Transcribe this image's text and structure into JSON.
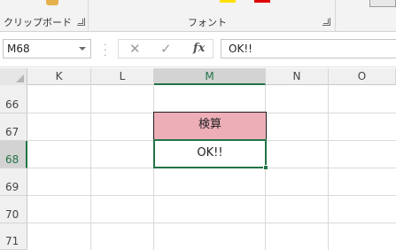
{
  "ribbon": {
    "clipboard_label": "クリップボード",
    "font_label": "フォント",
    "colors": {
      "highlight": "#ffe100",
      "font_red": "#e00000",
      "brush": "#e3b04b"
    }
  },
  "formula_bar": {
    "name_box": "M68",
    "cancel_icon": "✕",
    "enter_icon": "✓",
    "fx_icon": "fx",
    "content": "OK!!"
  },
  "columns": [
    "K",
    "L",
    "M",
    "N",
    "O"
  ],
  "active_column": "M",
  "rows": [
    "66",
    "67",
    "68",
    "69",
    "70",
    "71"
  ],
  "active_row": "68",
  "cells": {
    "M67": "検算",
    "M68": "OK!!"
  },
  "colors": {
    "accent": "#217346",
    "kensan_fill": "#edaeb8"
  }
}
